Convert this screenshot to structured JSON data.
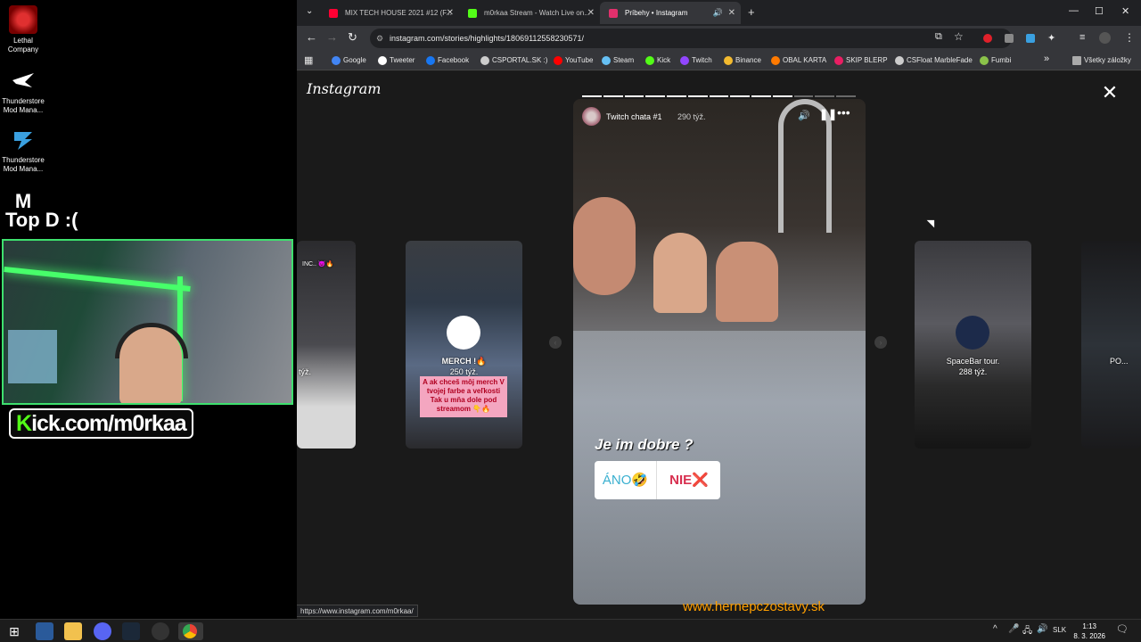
{
  "desktop": {
    "icons": [
      {
        "label": "Lethal Company",
        "icon": "lethal-company-icon"
      },
      {
        "label": "Thunderstore Mod Mana...",
        "icon": "thunderstore-icon"
      },
      {
        "label": "Thunderstore Mod Mana...",
        "icon": "thunderstore-icon"
      },
      {
        "label": "M Maps",
        "icon": "maps-icon"
      }
    ]
  },
  "overlay": {
    "top_text": "Top D :(",
    "kick_prefix": "K",
    "kick_text": "ick.com/m0rkaa"
  },
  "tabs": [
    {
      "title": "MIX TECH HOUSE 2021 #12 (F...",
      "color": "#ff0033",
      "muted": false
    },
    {
      "title": "m0rkaa Stream - Watch Live on...",
      "color": "#53fc18",
      "muted": false
    },
    {
      "title": "Príbehy • Instagram",
      "color": "#e1306c",
      "muted": true
    }
  ],
  "address": {
    "url": "instagram.com/stories/highlights/18069112558230571/"
  },
  "bookmarks": [
    {
      "label": "Google",
      "color": "#4285f4"
    },
    {
      "label": "Tweeter",
      "color": "#ffffff"
    },
    {
      "label": "Facebook",
      "color": "#1877f2"
    },
    {
      "label": "CSPORTAL.SK :)",
      "color": "#cccccc"
    },
    {
      "label": "YouTube",
      "color": "#ff0000"
    },
    {
      "label": "Steam",
      "color": "#66c0f4"
    },
    {
      "label": "Kick",
      "color": "#53fc18"
    },
    {
      "label": "Twitch",
      "color": "#9146ff"
    },
    {
      "label": "Binance",
      "color": "#f3ba2f"
    },
    {
      "label": "OBAL KARTA",
      "color": "#ff7a00"
    },
    {
      "label": "SKIP BLERP",
      "color": "#e91e63"
    },
    {
      "label": "CSFloat MarbleFade",
      "color": "#cccccc"
    },
    {
      "label": "Fumbi",
      "color": "#8bc34a"
    }
  ],
  "bookmarks_other": "Všetky záložky",
  "instagram": {
    "logo": "Instagram",
    "story": {
      "title": "Twitch chata #1",
      "age": "290 týž.",
      "question": "Je im dobre ?",
      "option_yes": "ÁNO🤣",
      "option_no": "NIE❌",
      "segments_total": 13,
      "segments_done": 10
    },
    "cards": [
      {
        "name": "",
        "age": "týž.",
        "caption": "",
        "top": "INC.. 😈🔥"
      },
      {
        "name": "MERCH !🔥",
        "age": "250 týž.",
        "caption": "A ak chceš môj merch V tvojej farbe a veľkosti Tak u mňa dole pod streamom 👇🔥"
      },
      {
        "name": "SpaceBar tour.",
        "age": "288 týž.",
        "caption": ""
      },
      {
        "name": "PO...",
        "age": "",
        "caption": ""
      }
    ]
  },
  "status_url": "https://www.instagram.com/m0rkaa/",
  "watermark": "www.hernepczostavy.sk",
  "taskbar": {
    "lang": "SLK",
    "time": "1:13",
    "date": "8. 3. 2026"
  }
}
